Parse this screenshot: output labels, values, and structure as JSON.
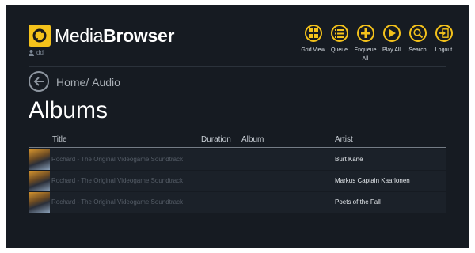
{
  "app": {
    "name_part1": "Media",
    "name_part2": "Browser",
    "user": "dd"
  },
  "toolbar": [
    {
      "icon": "grid-icon",
      "label": "Grid View"
    },
    {
      "icon": "queue-list-icon",
      "label": "Queue"
    },
    {
      "icon": "plus-icon",
      "label": "Enqueue All"
    },
    {
      "icon": "play-icon",
      "label": "Play All"
    },
    {
      "icon": "search-icon",
      "label": "Search"
    },
    {
      "icon": "logout-icon",
      "label": "Logout"
    }
  ],
  "breadcrumb": {
    "home": "Home",
    "separator": "/",
    "current": "Audio"
  },
  "page_title": "Albums",
  "table": {
    "headers": {
      "title": "Title",
      "duration": "Duration",
      "album": "Album",
      "artist": "Artist"
    },
    "rows": [
      {
        "title": "Rochard - The Original Videogame Soundtrack",
        "duration": "",
        "album": "",
        "artist": "Burt Kane"
      },
      {
        "title": "Rochard - The Original Videogame Soundtrack",
        "duration": "",
        "album": "",
        "artist": "Markus Captain Kaarlonen"
      },
      {
        "title": "Rochard - The Original Videogame Soundtrack",
        "duration": "",
        "album": "",
        "artist": "Poets of the Fall"
      }
    ]
  },
  "colors": {
    "accent": "#f4c21b",
    "background": "#161b22",
    "row": "#1b2129"
  }
}
